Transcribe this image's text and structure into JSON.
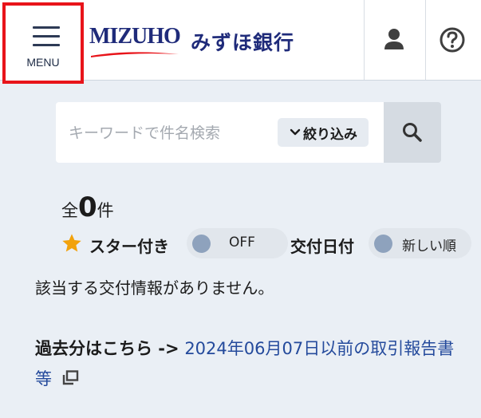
{
  "header": {
    "menu_label": "MENU",
    "logo_text_en": "MIZUHO",
    "logo_text_jp": "みずほ銀行",
    "account_icon": "user-icon",
    "help_icon": "help-circle-icon"
  },
  "search": {
    "placeholder": "キーワードで件名検索",
    "value": "",
    "refine_label": "絞り込み",
    "refine_icon": "chevron-down-icon",
    "search_icon": "search-icon"
  },
  "results": {
    "count_prefix": "全",
    "count_value": "0",
    "count_suffix": "件"
  },
  "filters": {
    "star_label": "スター付き",
    "star_toggle_text": "OFF",
    "date_label": "交付日付",
    "order_toggle_text": "新しい順"
  },
  "empty_message": "該当する交付情報がありません。",
  "past": {
    "label": "過去分はこちら ->",
    "link_text": "2024年06月07日以前の取引報告書等",
    "link_icon": "external-window-icon"
  },
  "colors": {
    "highlight_border": "#e8141a",
    "brand": "#1f2b7a",
    "link": "#244a9c",
    "page_bg": "#eaeff5"
  }
}
